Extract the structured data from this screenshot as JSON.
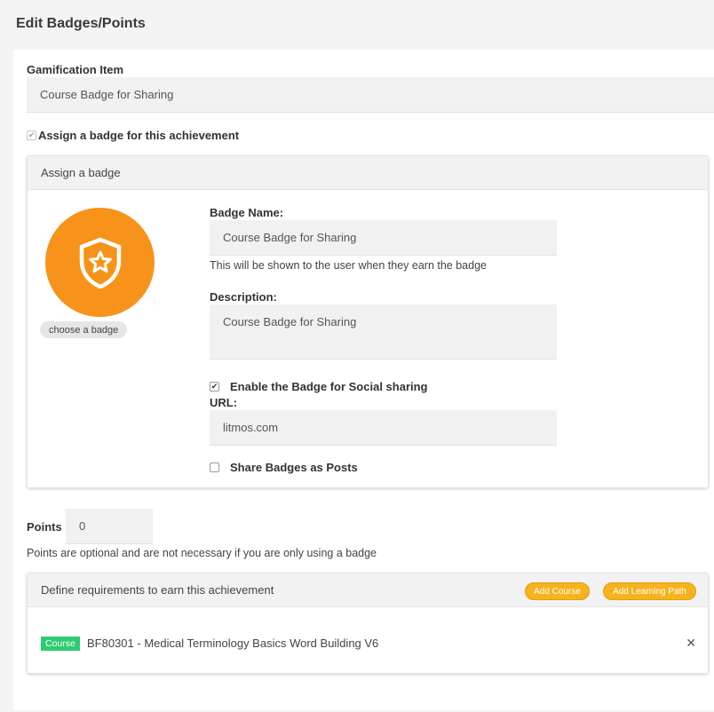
{
  "page": {
    "title": "Edit Badges/Points"
  },
  "gamification": {
    "label": "Gamification Item",
    "value": "Course Badge for Sharing",
    "assign_checkbox_label": "Assign a badge for this achievement",
    "assign_checked": true
  },
  "badge_card": {
    "header": "Assign a badge",
    "choose_button": "choose a badge",
    "icon": "shield-star-icon",
    "badge_color": "#f7931a",
    "name_label": "Badge Name:",
    "name_value": "Course Badge for Sharing",
    "name_help": "This will be shown to the user when they earn the badge",
    "description_label": "Description:",
    "description_value": "Course Badge for Sharing",
    "social_checkbox_label": "Enable the Badge for Social sharing",
    "social_checked": true,
    "url_label": "URL:",
    "url_value": "litmos.com",
    "share_posts_label": "Share Badges as Posts",
    "share_posts_checked": false
  },
  "points": {
    "label": "Points",
    "value": "0",
    "help": "Points are optional and are not necessary if you are only using a badge"
  },
  "requirements": {
    "header": "Define requirements to earn this achievement",
    "add_course_label": "Add Course",
    "add_learning_path_label": "Add Learning Path",
    "button_color": "#f5b31d",
    "items": [
      {
        "tag": "Course",
        "tag_color": "#2ecc71",
        "name": "BF80301 - Medical Terminology Basics Word Building V6",
        "remove_icon": "close-icon"
      }
    ]
  }
}
